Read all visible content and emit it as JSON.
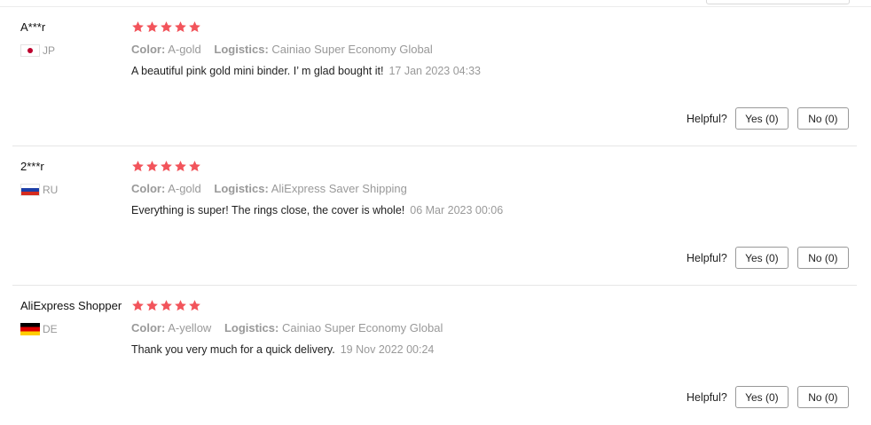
{
  "reviews": [
    {
      "name": "A***r",
      "country": "JP",
      "flag": "flag-jp-icon",
      "rating": 5,
      "color_label": "Color:",
      "color_value": "A-gold",
      "logistics_label": "Logistics:",
      "logistics_value": "Cainiao Super Economy Global",
      "text": "A beautiful pink gold mini binder. I’ m glad bought it!",
      "date": "17 Jan 2023 04:33",
      "helpful_label": "Helpful?",
      "yes_label": "Yes (0)",
      "no_label": "No (0)"
    },
    {
      "name": "2***r",
      "country": "RU",
      "flag": "flag-ru-icon",
      "rating": 5,
      "color_label": "Color:",
      "color_value": "A-gold",
      "logistics_label": "Logistics:",
      "logistics_value": "AliExpress Saver Shipping",
      "text": "Everything is super! The rings close, the cover is whole!",
      "date": "06 Mar 2023 00:06",
      "helpful_label": "Helpful?",
      "yes_label": "Yes (0)",
      "no_label": "No (0)"
    },
    {
      "name": "AliExpress Shopper",
      "country": "DE",
      "flag": "flag-de-icon",
      "rating": 5,
      "color_label": "Color:",
      "color_value": "A-yellow",
      "logistics_label": "Logistics:",
      "logistics_value": "Cainiao Super Economy Global",
      "text": "Thank you very much for a quick delivery.",
      "date": "19 Nov 2022 00:24",
      "helpful_label": "Helpful?",
      "yes_label": "Yes (0)",
      "no_label": "No (0)"
    }
  ],
  "colors": {
    "star": "#f2545b",
    "muted": "#999999"
  }
}
